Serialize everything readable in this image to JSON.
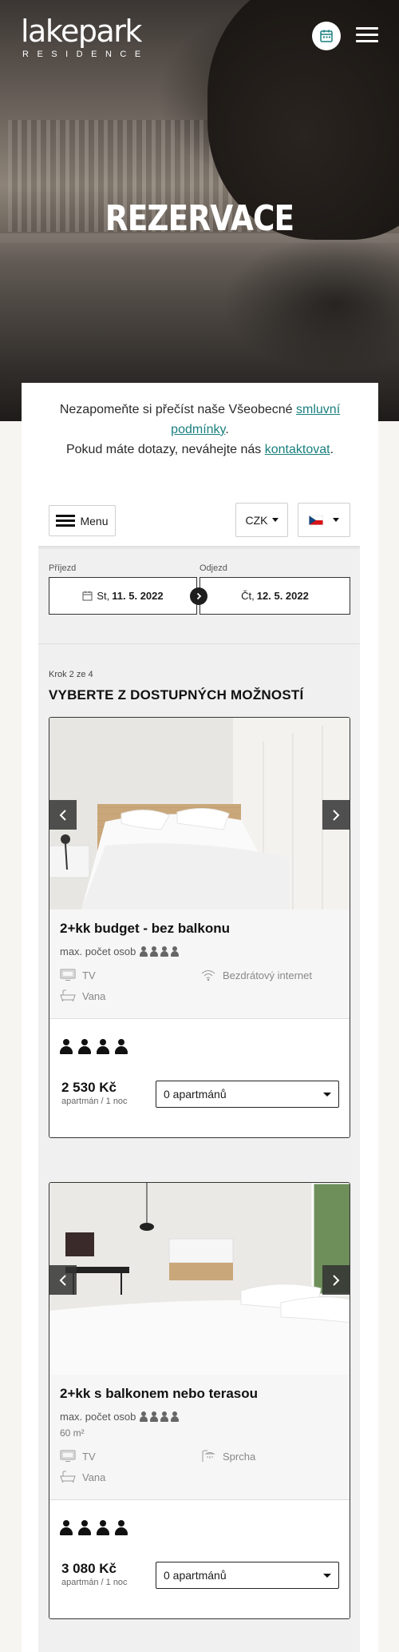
{
  "header": {
    "logo_main": "lakepark",
    "logo_sub": "RESIDENCE",
    "title": "REZERVACE"
  },
  "notice": {
    "line1_prefix": "Nezapomeňte si přečíst naše Všeobecné ",
    "line1_link": "smluvní podmínky",
    "line1_suffix": ".",
    "line2_prefix": "Pokud máte dotazy, neváhejte nás ",
    "line2_link": "kontaktovat",
    "line2_suffix": "."
  },
  "toolbar": {
    "menu_label": "Menu",
    "currency": "CZK"
  },
  "dates": {
    "arrival_label": "Příjezd",
    "arrival_day": "St,",
    "arrival_date": "11. 5. 2022",
    "departure_label": "Odjezd",
    "departure_day": "Čt,",
    "departure_date": "12. 5. 2022"
  },
  "step": {
    "counter": "Krok 2 ze 4",
    "title": "VYBERTE Z DOSTUPNÝCH MOŽNOSTÍ"
  },
  "rooms": [
    {
      "name": "2+kk budget - bez balkonu",
      "max_persons_label": "max. počet osob",
      "area": "",
      "amenities": [
        "TV",
        "Bezdrátový internet",
        "Vana"
      ],
      "price": "2 530 Kč",
      "price_unit": "apartmán / 1 noc",
      "select_value": "0 apartmánů"
    },
    {
      "name": "2+kk s balkonem nebo terasou",
      "max_persons_label": "max. počet osob",
      "area": "60 m²",
      "amenities": [
        "TV",
        "Sprcha",
        "Vana"
      ],
      "price": "3 080 Kč",
      "price_unit": "apartmán / 1 noc",
      "select_value": "0 apartmánů"
    }
  ],
  "colors": {
    "accent_link": "#1a7f7f",
    "page_bg": "#f7f5f1"
  }
}
